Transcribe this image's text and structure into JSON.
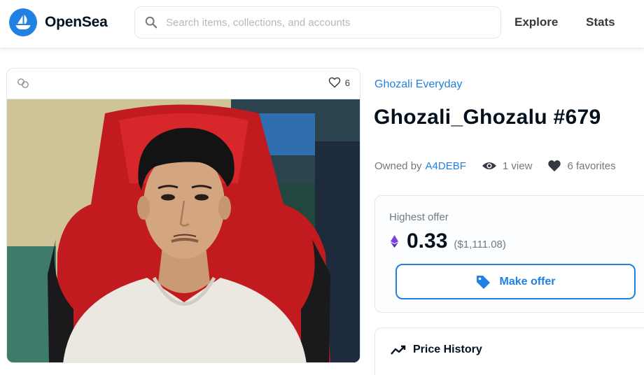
{
  "header": {
    "brand": "OpenSea",
    "search_placeholder": "Search items, collections, and accounts",
    "nav": [
      "Explore",
      "Stats"
    ]
  },
  "asset_card": {
    "chain_icon": "link-icon",
    "favorites_count": "6"
  },
  "details": {
    "collection": "Ghozali Everyday",
    "title": "Ghozali_Ghozalu #679",
    "owned_by_label": "Owned by",
    "owner": "A4DEBF",
    "views": "1 view",
    "favorites": "6 favorites"
  },
  "offer": {
    "label": "Highest offer",
    "price": "0.33",
    "usd": "($1,111.08)",
    "button": "Make offer"
  },
  "price_history": {
    "label": "Price History"
  },
  "colors": {
    "accent": "#2081e2",
    "text": "#353840",
    "muted": "#707a83",
    "eth": "#7b3fe4"
  }
}
